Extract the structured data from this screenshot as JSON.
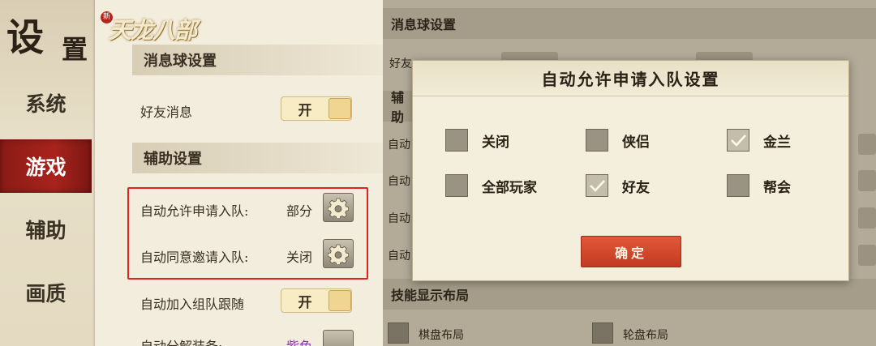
{
  "sidebar": {
    "title_big": "设",
    "title_small": "置",
    "logo_seal": "新",
    "logo_text": "天龙八部",
    "items": [
      {
        "label": "系统"
      },
      {
        "label": "游戏",
        "active": true
      },
      {
        "label": "辅助"
      },
      {
        "label": "画质"
      }
    ]
  },
  "settings": {
    "section_message_ball": "消息球设置",
    "friend_message_label": "好友消息",
    "friend_message_value": "开",
    "section_assist": "辅助设置",
    "auto_allow_team_label": "自动允许申请入队:",
    "auto_allow_team_value": "部分",
    "auto_accept_invite_label": "自动同意邀请入队:",
    "auto_accept_invite_value": "关闭",
    "auto_join_follow_label": "自动加入组队跟随",
    "auto_join_follow_value": "开",
    "auto_decompose_label": "自动分解装备:",
    "auto_decompose_value": "紫色"
  },
  "background": {
    "section_message_ball": "消息球设置",
    "friend_partial": "好友",
    "assist_partial": "辅助",
    "auto_partial": "自动",
    "section_skill_layout": "技能显示布局",
    "layout_chessboard": "棋盘布局",
    "layout_wheel": "轮盘布局"
  },
  "dialog": {
    "title": "自动允许申请入队设置",
    "options": [
      {
        "label": "关闭",
        "checked": false
      },
      {
        "label": "侠侣",
        "checked": false
      },
      {
        "label": "金兰",
        "checked": true
      },
      {
        "label": "全部玩家",
        "checked": false
      },
      {
        "label": "好友",
        "checked": true
      },
      {
        "label": "帮会",
        "checked": false
      }
    ],
    "confirm_label": "确定"
  },
  "colors": {
    "active_tab": "#a8231c",
    "highlight_box": "#e02424",
    "confirm_button": "#d44a2e",
    "purple_value": "#8a3aa8"
  }
}
